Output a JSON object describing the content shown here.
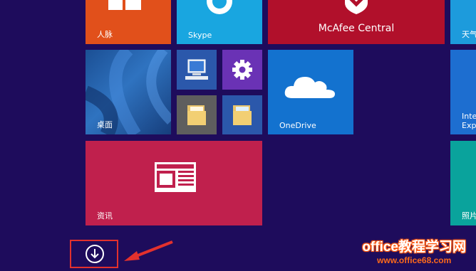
{
  "tiles": {
    "people": {
      "label": "人脉"
    },
    "skype": {
      "label": "Skype"
    },
    "mcafee": {
      "label": "McAfee Central"
    },
    "weather": {
      "label": "天气"
    },
    "desktop": {
      "label": "桌面"
    },
    "onedrive": {
      "label": "OneDrive"
    },
    "ie": {
      "label_line1": "Inte",
      "label_line2": "Exp"
    },
    "news": {
      "label": "资讯"
    },
    "photos": {
      "label": "照片"
    }
  },
  "icons": {
    "people": "people-icon",
    "skype": "skype-icon",
    "mcafee": "mcafee-shield-icon",
    "computer": "computer-icon",
    "settings": "gear-icon",
    "folder": "folder-icon",
    "onedrive": "cloud-icon",
    "ie": "internet-explorer-icon",
    "news": "newspaper-icon",
    "down": "arrow-down-circle-icon"
  },
  "colors": {
    "background": "#1e0c5c",
    "people": "#e1501b",
    "skype": "#19a6e0",
    "mcafee": "#b1102b",
    "news": "#c0204d",
    "onedrive": "#1372cf",
    "highlight": "#e2312d"
  },
  "watermark": {
    "title": "office教程学习网",
    "url": "www.office68.com"
  }
}
